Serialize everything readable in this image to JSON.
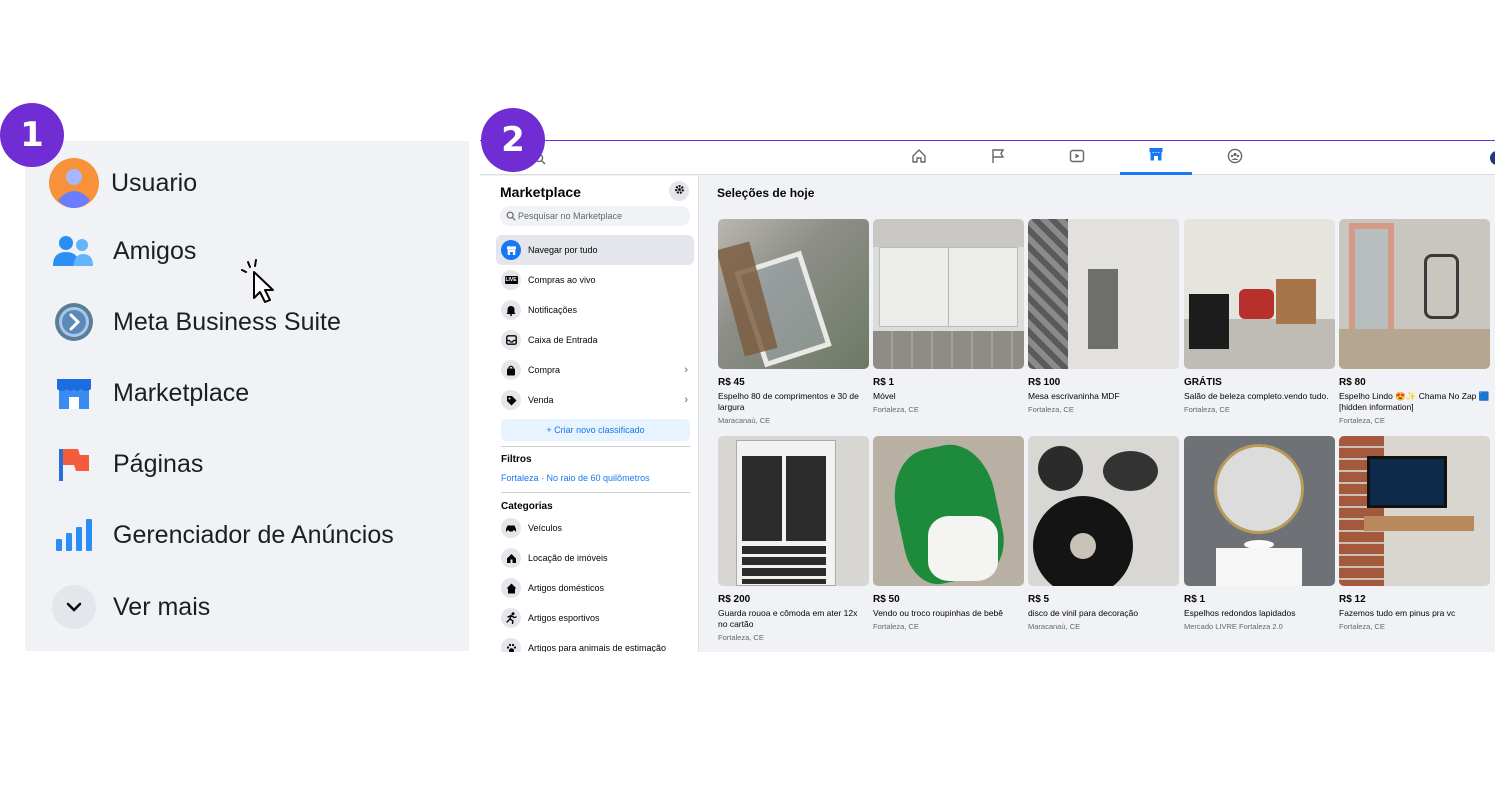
{
  "badges": [
    "1",
    "2"
  ],
  "panel1": {
    "items": [
      {
        "label": "Usuario",
        "icon": "avatar-icon"
      },
      {
        "label": "Amigos",
        "icon": "friends-icon"
      },
      {
        "label": "Meta Business Suite",
        "icon": "meta-business-suite-icon"
      },
      {
        "label": "Marketplace",
        "icon": "marketplace-icon"
      },
      {
        "label": "Páginas",
        "icon": "pages-flag-icon"
      },
      {
        "label": "Gerenciador de Anúncios",
        "icon": "ads-manager-icon"
      },
      {
        "label": "Ver mais",
        "icon": "chevron-down-icon"
      }
    ]
  },
  "panel2": {
    "sidebar": {
      "title": "Marketplace",
      "search_placeholder": "Pesquisar no Marketplace",
      "items": [
        {
          "label": "Navegar por tudo",
          "icon": "store-icon",
          "active": true
        },
        {
          "label": "Compras ao vivo",
          "icon": "live-icon"
        },
        {
          "label": "Notificações",
          "icon": "bell-icon"
        },
        {
          "label": "Caixa de Entrada",
          "icon": "inbox-icon"
        },
        {
          "label": "Compra",
          "icon": "bag-icon"
        },
        {
          "label": "Venda",
          "icon": "tag-icon"
        }
      ],
      "create_button": "+ Criar novo classificado",
      "filters_title": "Filtros",
      "filters_location": "Fortaleza · No raio de 60 quilômetros",
      "categories_title": "Categorias",
      "categories": [
        {
          "label": "Veículos",
          "icon": "car-icon"
        },
        {
          "label": "Locação de imóveis",
          "icon": "house-key-icon"
        },
        {
          "label": "Artigos domésticos",
          "icon": "home-icon"
        },
        {
          "label": "Artigos esportivos",
          "icon": "runner-icon"
        },
        {
          "label": "Artigos para animais de estimação",
          "icon": "paw-icon"
        }
      ]
    },
    "section_title": "Seleções de hoje",
    "listings": [
      {
        "price": "R$ 45",
        "title": "Espelho 80 de comprimentos e 30 de largura",
        "location": "Maracanaú, CE"
      },
      {
        "price": "R$ 1",
        "title": "Móvel",
        "location": "Fortaleza, CE"
      },
      {
        "price": "R$ 100",
        "title": "Mesa escrivaninha MDF",
        "location": "Fortaleza, CE"
      },
      {
        "price": "GRÁTIS",
        "title": "Salão de beleza completo.vendo tudo.",
        "location": "Fortaleza, CE"
      },
      {
        "price": "R$ 80",
        "title": "Espelho Lindo 😍✨ Chama No Zap 🟦 [hidden information]",
        "location": "Fortaleza, CE"
      },
      {
        "price": "R$ 200",
        "title": "Guarda rouoa e cômoda em ater 12x no cartão",
        "location": "Fortaleza, CE"
      },
      {
        "price": "R$ 50",
        "title": "Vendo ou troco roupinhas de bebê",
        "location": "Fortaleza, CE"
      },
      {
        "price": "R$ 5",
        "title": "disco de vinil para decoração",
        "location": "Maracanaú, CE"
      },
      {
        "price": "R$ 1",
        "title": "Espelhos redondos lapidados",
        "location": "Mercado LIVRE Fortaleza 2.0"
      },
      {
        "price": "R$ 12",
        "title": "Fazemos tudo em pinus pra vc",
        "location": "Fortaleza, CE"
      }
    ]
  }
}
